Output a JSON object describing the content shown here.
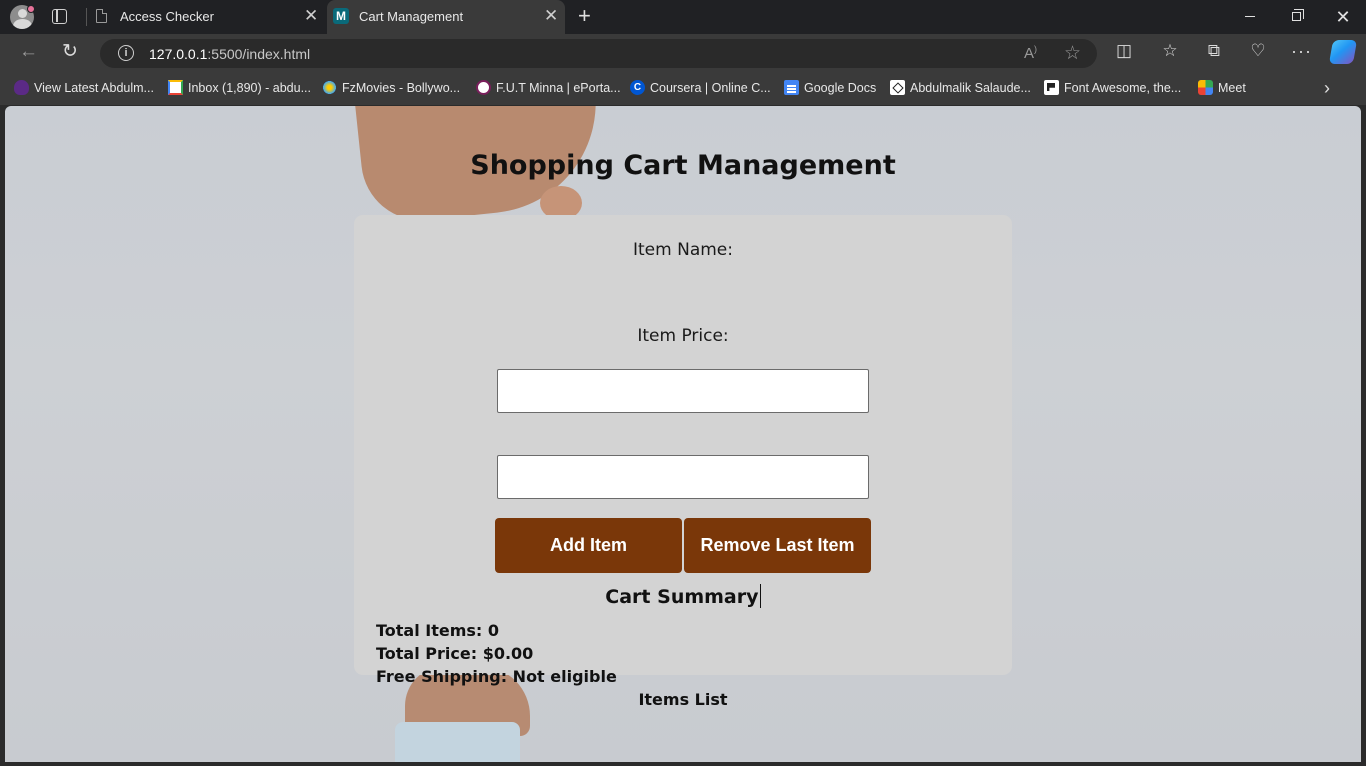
{
  "browser": {
    "tabs": [
      {
        "title": "Access Checker",
        "icon": "page-icon"
      },
      {
        "title": "Cart Management",
        "icon": "m-site-icon",
        "active": true
      }
    ],
    "url_host": "127.0.0.1",
    "url_path": ":5500/index.html",
    "bookmarks": [
      {
        "label": "View Latest Abdulm...",
        "icon": "va-icon"
      },
      {
        "label": "Inbox (1,890) - abdu...",
        "icon": "gmail-icon"
      },
      {
        "label": "FzMovies - Bollywo...",
        "icon": "fzmovies-icon"
      },
      {
        "label": "F.U.T Minna | ePorta...",
        "icon": "fut-icon"
      },
      {
        "label": "Coursera | Online C...",
        "icon": "coursera-icon"
      },
      {
        "label": "Google Docs",
        "icon": "docs-icon"
      },
      {
        "label": "Abdulmalik Salaude...",
        "icon": "codepen-icon"
      },
      {
        "label": "Font Awesome, the...",
        "icon": "fontawesome-icon"
      },
      {
        "label": "Meet",
        "icon": "meet-icon"
      }
    ]
  },
  "page": {
    "title": "Shopping Cart Management",
    "item_name_label": "Item Name:",
    "item_name_value": "",
    "item_price_label": "Item Price:",
    "item_price_value": "",
    "add_button": "Add Item",
    "remove_button": "Remove Last Item",
    "summary_title": "Cart Summary",
    "total_items": "Total Items: 0",
    "total_price": "Total Price: $0.00",
    "free_shipping": "Free Shipping: Not eligible",
    "items_list_title": "Items List"
  },
  "colors": {
    "button": "#7a3709",
    "card": "#d3d3d3",
    "browser_chrome": "#3a3a3a"
  }
}
